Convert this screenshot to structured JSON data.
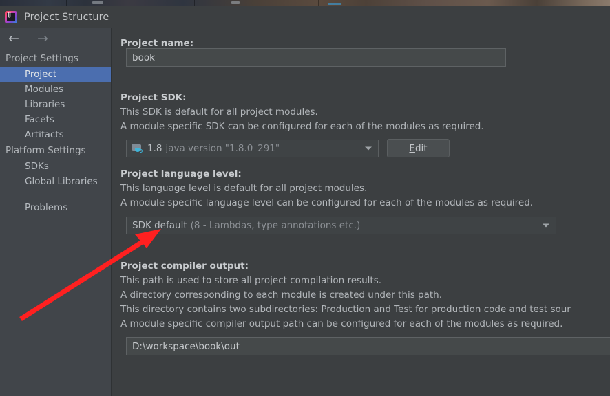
{
  "window": {
    "title": "Project Structure",
    "logo_icon": "intellij-idea-logo"
  },
  "nav": {
    "back_icon": "arrow-left-icon",
    "forward_icon": "arrow-right-icon"
  },
  "sidebar": {
    "groups": [
      {
        "label": "Project Settings",
        "items": [
          {
            "label": "Project",
            "selected": true
          },
          {
            "label": "Modules",
            "selected": false
          },
          {
            "label": "Libraries",
            "selected": false
          },
          {
            "label": "Facets",
            "selected": false
          },
          {
            "label": "Artifacts",
            "selected": false
          }
        ]
      },
      {
        "label": "Platform Settings",
        "items": [
          {
            "label": "SDKs",
            "selected": false
          },
          {
            "label": "Global Libraries",
            "selected": false
          }
        ]
      }
    ],
    "problems": "Problems"
  },
  "main": {
    "project_name": {
      "label": "Project name:",
      "value": "book"
    },
    "project_sdk": {
      "label": "Project SDK:",
      "desc1": "This SDK is default for all project modules.",
      "desc2": "A module specific SDK can be configured for each of the modules as required.",
      "combo_icon": "java-sdk-folder-icon",
      "combo_primary": "1.8",
      "combo_secondary": "java version \"1.8.0_291\"",
      "dropdown_icon": "chevron-down-icon",
      "edit_button_mnemonic": "E",
      "edit_button_rest": "dit"
    },
    "language_level": {
      "label": "Project language level:",
      "desc1": "This language level is default for all project modules.",
      "desc2": "A module specific language level can be configured for each of the modules as required.",
      "combo_primary": "SDK default",
      "combo_secondary": "(8 - Lambdas, type annotations etc.)",
      "dropdown_icon": "chevron-down-icon"
    },
    "compiler_output": {
      "label": "Project compiler output:",
      "desc1": "This path is used to store all project compilation results.",
      "desc2": "A directory corresponding to each module is created under this path.",
      "desc3": "This directory contains two subdirectories: Production and Test for production code and test sour",
      "desc4": "A module specific compiler output path can be configured for each of the modules as required.",
      "value": "D:\\workspace\\book\\out"
    }
  },
  "annotation": {
    "arrow_color": "#ff2020",
    "arrow_name": "red-pointer-arrow"
  },
  "colors": {
    "selection": "#4b6eaf",
    "sidebar_bg": "#41454a",
    "panel_bg": "#3c3f41",
    "accent_red": "#ff2020"
  }
}
